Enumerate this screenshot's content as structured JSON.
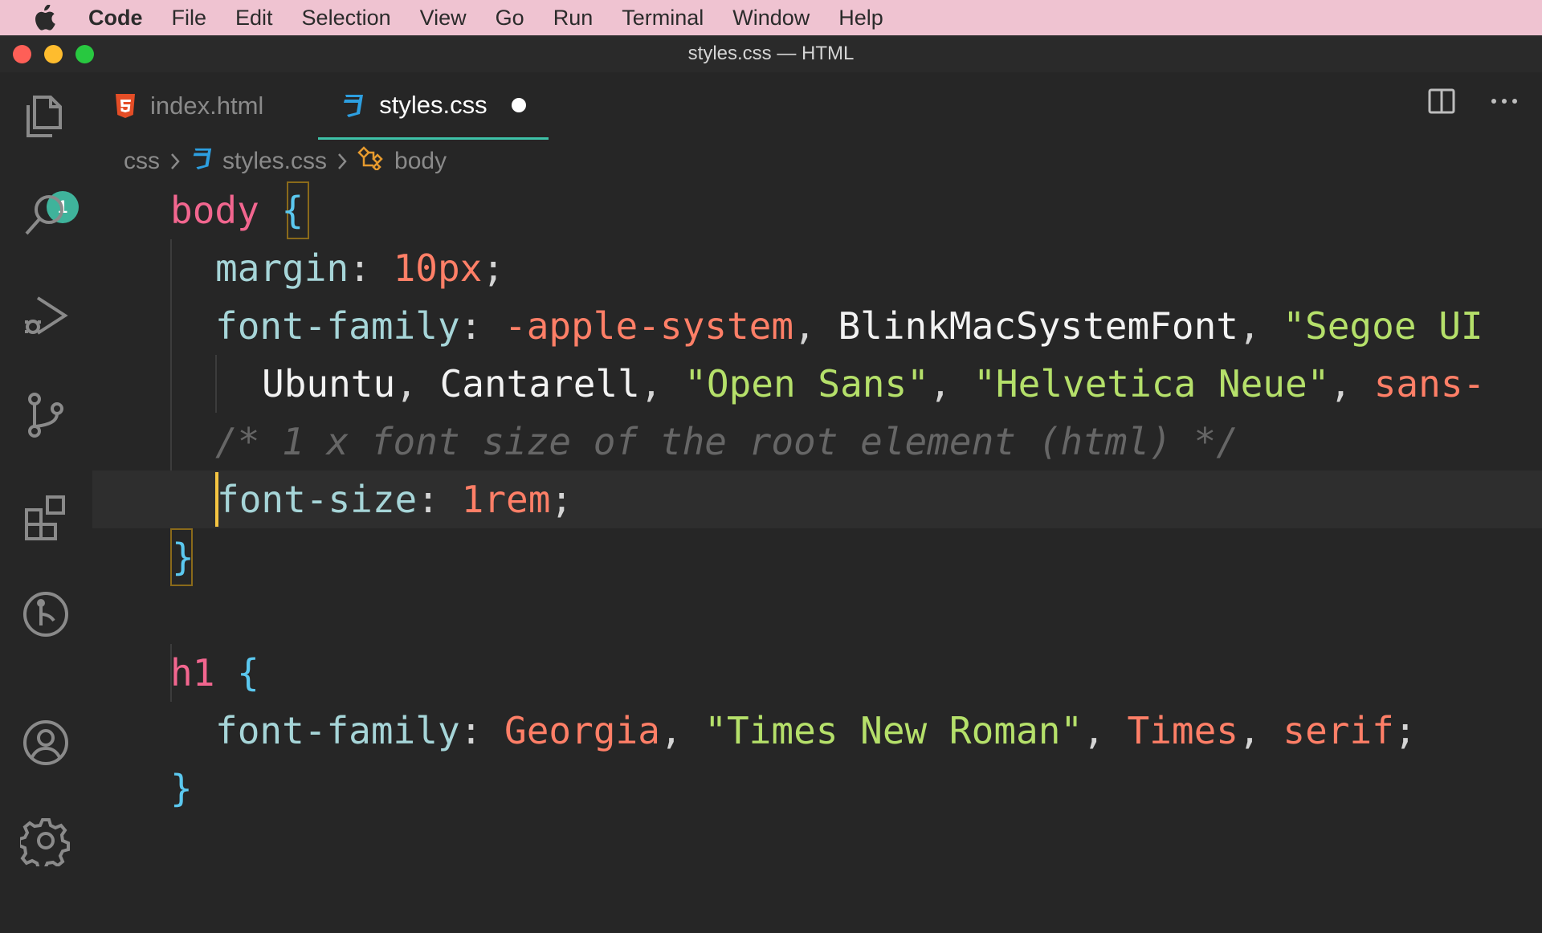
{
  "menubar": {
    "app": "Code",
    "items": [
      "File",
      "Edit",
      "Selection",
      "View",
      "Go",
      "Run",
      "Terminal",
      "Window",
      "Help"
    ]
  },
  "window": {
    "title": "styles.css — HTML"
  },
  "activity_bar": {
    "explorer_badge": "1",
    "icons": [
      "files-icon",
      "search-icon",
      "run-debug-icon",
      "source-control-icon",
      "extensions-icon",
      "remote-icon",
      "account-icon",
      "settings-gear-icon"
    ]
  },
  "tabs": [
    {
      "label": "index.html",
      "icon": "html5-icon",
      "active": false
    },
    {
      "label": "styles.css",
      "icon": "css3-icon",
      "active": true,
      "dirty": true
    }
  ],
  "breadcrumb": {
    "folder": "css",
    "file": "styles.css",
    "symbol": "body"
  },
  "code": {
    "l1": {
      "selector": "body",
      "brace": "{"
    },
    "l2": {
      "prop": "margin",
      "colon": ": ",
      "value": "10px",
      "semi": ";"
    },
    "l3": {
      "prop": "font-family",
      "colon": ": ",
      "v1": "-apple-system",
      "c1": ", ",
      "v2": "BlinkMacSystemFont",
      "c2": ", ",
      "v3": "\"Segoe UI"
    },
    "l4": {
      "v1": "Ubuntu",
      "c1": ", ",
      "v2": "Cantarell",
      "c2": ", ",
      "v3": "\"Open Sans\"",
      "c3": ", ",
      "v4": "\"Helvetica Neue\"",
      "c4": ", ",
      "v5": "sans-"
    },
    "l5": {
      "comment": "/* 1 x font size of the root element (html) */"
    },
    "l6": {
      "prop": "font-size",
      "colon": ": ",
      "value": "1rem",
      "semi": ";"
    },
    "l7": {
      "brace": "}"
    },
    "l9": {
      "selector": "h1",
      "brace": "{"
    },
    "l10": {
      "prop": "font-family",
      "colon": ": ",
      "v1": "Georgia",
      "c1": ", ",
      "v2": "\"Times New Roman\"",
      "c2": ", ",
      "v3": "Times",
      "c3": ", ",
      "v4": "serif",
      "semi": ";"
    },
    "l11": {
      "brace": "}"
    }
  },
  "colors": {
    "menubar": "#efc3d1",
    "editor_bg": "#262626",
    "accent_tab": "#3ec2a8",
    "badge": "#3fb39b"
  }
}
